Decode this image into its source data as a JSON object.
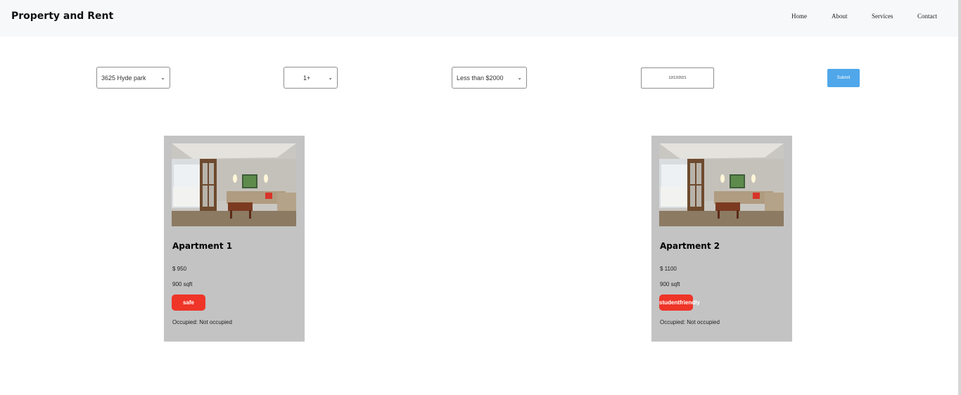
{
  "navbar": {
    "brand": "Property and Rent",
    "links": [
      "Home",
      "About",
      "Services",
      "Contact"
    ]
  },
  "filters": {
    "location": "3625 Hyde park",
    "bedrooms": "1+",
    "price": "Less than $2000",
    "date": "12/12/2021",
    "submit_label": "Submit"
  },
  "listings": [
    {
      "title": "Apartment 1",
      "price": "$ 950",
      "area": "900 sqft",
      "tag": "safe",
      "occupancy": "Occupied: Not occupied"
    },
    {
      "title": "Apartment 2",
      "price": "$ 1100",
      "area": "900 sqft",
      "tag": "studentfriendly",
      "occupancy": "Occupied: Not occupied"
    }
  ],
  "colors": {
    "navbar_bg": "#f7f8fa",
    "card_bg": "#c3c3c3",
    "tag_bg": "#ee3528",
    "submit_bg": "#4fa7ea"
  }
}
